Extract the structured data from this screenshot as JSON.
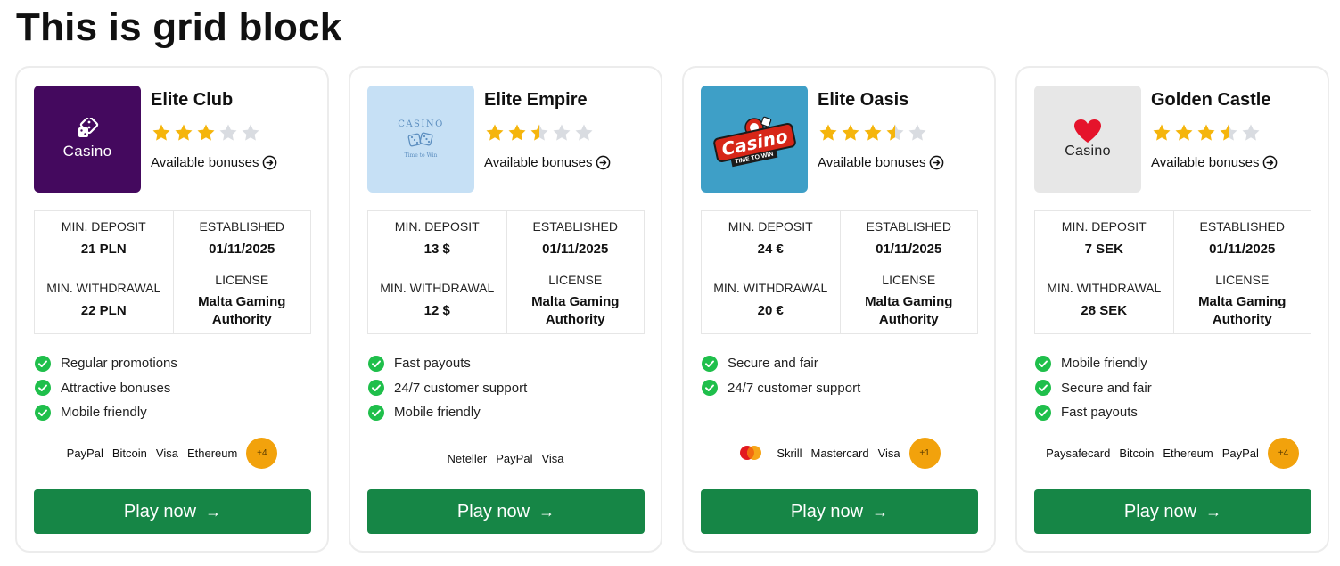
{
  "page": {
    "title": "This is grid block"
  },
  "colors": {
    "accent_green": "#168646",
    "star_gold": "#f5b50c",
    "star_empty": "#d9dce1",
    "badge_orange": "#f2a20c",
    "check_green": "#1fbf4b"
  },
  "labels": {
    "available_bonuses": "Available bonuses",
    "min_deposit": "MIN. DEPOSIT",
    "established": "ESTABLISHED",
    "min_withdrawal": "MIN. WITHDRAWAL",
    "license": "LICENSE",
    "play_now": "Play now"
  },
  "cards": [
    {
      "name": "Elite Club",
      "logo_text": "Casino",
      "rating": 3,
      "min_deposit": "21 PLN",
      "established": "01/11/2025",
      "min_withdrawal": "22 PLN",
      "license": "Malta Gaming Authority",
      "features": [
        "Regular promotions",
        "Attractive bonuses",
        "Mobile friendly"
      ],
      "payments": [
        "PayPal",
        "Bitcoin",
        "Visa",
        "Ethereum"
      ],
      "more": "+4"
    },
    {
      "name": "Elite Empire",
      "logo_text": "CASINO",
      "logo_subtext": "Time to Win",
      "rating": 2.5,
      "min_deposit": "13 $",
      "established": "01/11/2025",
      "min_withdrawal": "12 $",
      "license": "Malta Gaming Authority",
      "features": [
        "Fast payouts",
        "24/7 customer support",
        "Mobile friendly"
      ],
      "payments": [
        "Neteller",
        "PayPal",
        "Visa"
      ],
      "more": ""
    },
    {
      "name": "Elite Oasis",
      "logo_text": "Casino",
      "logo_subtext": "TIME TO WIN",
      "rating": 3.5,
      "min_deposit": "24 €",
      "established": "01/11/2025",
      "min_withdrawal": "20 €",
      "license": "Malta Gaming Authority",
      "features": [
        "Secure and fair",
        "24/7 customer support"
      ],
      "payments": [
        "Skrill",
        "Mastercard",
        "Visa"
      ],
      "more": "+1"
    },
    {
      "name": "Golden Castle",
      "logo_text": "Casino",
      "rating": 3.5,
      "min_deposit": "7 SEK",
      "established": "01/11/2025",
      "min_withdrawal": "28 SEK",
      "license": "Malta Gaming Authority",
      "features": [
        "Mobile friendly",
        "Secure and fair",
        "Fast payouts"
      ],
      "payments": [
        "Paysafecard",
        "Bitcoin",
        "Ethereum",
        "PayPal"
      ],
      "more": "+4"
    }
  ]
}
